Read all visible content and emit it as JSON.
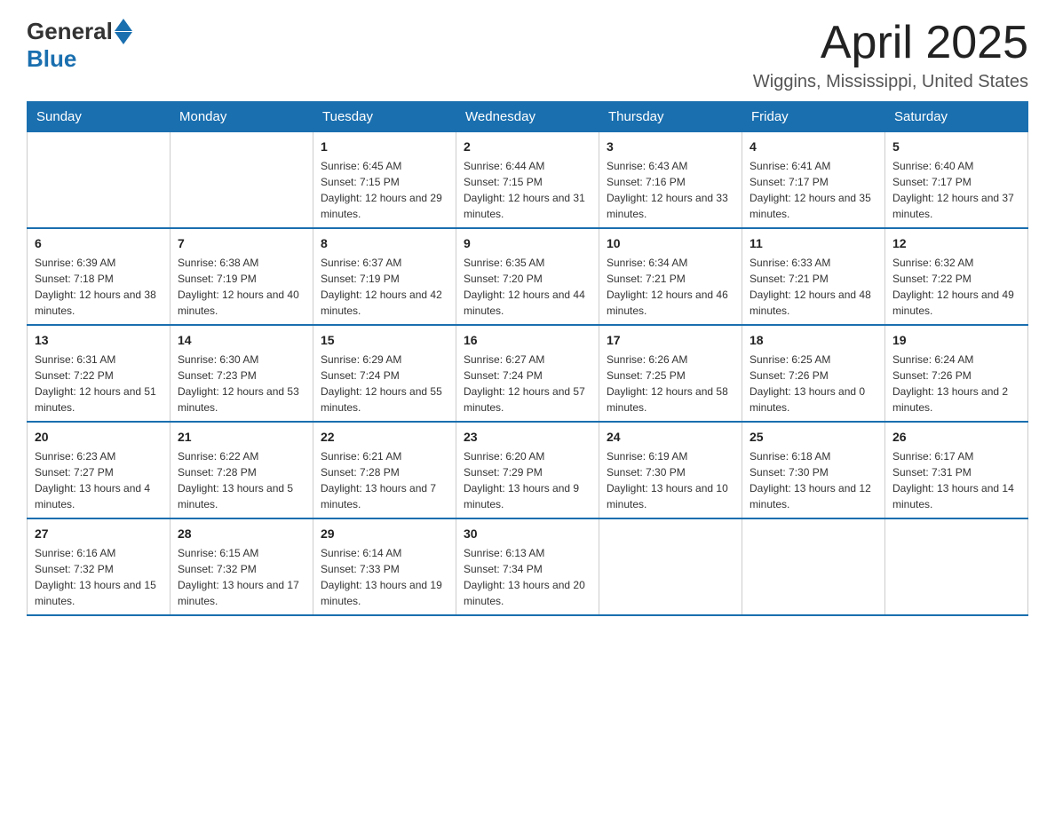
{
  "header": {
    "logo_general": "General",
    "logo_blue": "Blue",
    "month_year": "April 2025",
    "location": "Wiggins, Mississippi, United States"
  },
  "days_of_week": [
    "Sunday",
    "Monday",
    "Tuesday",
    "Wednesday",
    "Thursday",
    "Friday",
    "Saturday"
  ],
  "weeks": [
    [
      {
        "day": "",
        "sunrise": "",
        "sunset": "",
        "daylight": ""
      },
      {
        "day": "",
        "sunrise": "",
        "sunset": "",
        "daylight": ""
      },
      {
        "day": "1",
        "sunrise": "Sunrise: 6:45 AM",
        "sunset": "Sunset: 7:15 PM",
        "daylight": "Daylight: 12 hours and 29 minutes."
      },
      {
        "day": "2",
        "sunrise": "Sunrise: 6:44 AM",
        "sunset": "Sunset: 7:15 PM",
        "daylight": "Daylight: 12 hours and 31 minutes."
      },
      {
        "day": "3",
        "sunrise": "Sunrise: 6:43 AM",
        "sunset": "Sunset: 7:16 PM",
        "daylight": "Daylight: 12 hours and 33 minutes."
      },
      {
        "day": "4",
        "sunrise": "Sunrise: 6:41 AM",
        "sunset": "Sunset: 7:17 PM",
        "daylight": "Daylight: 12 hours and 35 minutes."
      },
      {
        "day": "5",
        "sunrise": "Sunrise: 6:40 AM",
        "sunset": "Sunset: 7:17 PM",
        "daylight": "Daylight: 12 hours and 37 minutes."
      }
    ],
    [
      {
        "day": "6",
        "sunrise": "Sunrise: 6:39 AM",
        "sunset": "Sunset: 7:18 PM",
        "daylight": "Daylight: 12 hours and 38 minutes."
      },
      {
        "day": "7",
        "sunrise": "Sunrise: 6:38 AM",
        "sunset": "Sunset: 7:19 PM",
        "daylight": "Daylight: 12 hours and 40 minutes."
      },
      {
        "day": "8",
        "sunrise": "Sunrise: 6:37 AM",
        "sunset": "Sunset: 7:19 PM",
        "daylight": "Daylight: 12 hours and 42 minutes."
      },
      {
        "day": "9",
        "sunrise": "Sunrise: 6:35 AM",
        "sunset": "Sunset: 7:20 PM",
        "daylight": "Daylight: 12 hours and 44 minutes."
      },
      {
        "day": "10",
        "sunrise": "Sunrise: 6:34 AM",
        "sunset": "Sunset: 7:21 PM",
        "daylight": "Daylight: 12 hours and 46 minutes."
      },
      {
        "day": "11",
        "sunrise": "Sunrise: 6:33 AM",
        "sunset": "Sunset: 7:21 PM",
        "daylight": "Daylight: 12 hours and 48 minutes."
      },
      {
        "day": "12",
        "sunrise": "Sunrise: 6:32 AM",
        "sunset": "Sunset: 7:22 PM",
        "daylight": "Daylight: 12 hours and 49 minutes."
      }
    ],
    [
      {
        "day": "13",
        "sunrise": "Sunrise: 6:31 AM",
        "sunset": "Sunset: 7:22 PM",
        "daylight": "Daylight: 12 hours and 51 minutes."
      },
      {
        "day": "14",
        "sunrise": "Sunrise: 6:30 AM",
        "sunset": "Sunset: 7:23 PM",
        "daylight": "Daylight: 12 hours and 53 minutes."
      },
      {
        "day": "15",
        "sunrise": "Sunrise: 6:29 AM",
        "sunset": "Sunset: 7:24 PM",
        "daylight": "Daylight: 12 hours and 55 minutes."
      },
      {
        "day": "16",
        "sunrise": "Sunrise: 6:27 AM",
        "sunset": "Sunset: 7:24 PM",
        "daylight": "Daylight: 12 hours and 57 minutes."
      },
      {
        "day": "17",
        "sunrise": "Sunrise: 6:26 AM",
        "sunset": "Sunset: 7:25 PM",
        "daylight": "Daylight: 12 hours and 58 minutes."
      },
      {
        "day": "18",
        "sunrise": "Sunrise: 6:25 AM",
        "sunset": "Sunset: 7:26 PM",
        "daylight": "Daylight: 13 hours and 0 minutes."
      },
      {
        "day": "19",
        "sunrise": "Sunrise: 6:24 AM",
        "sunset": "Sunset: 7:26 PM",
        "daylight": "Daylight: 13 hours and 2 minutes."
      }
    ],
    [
      {
        "day": "20",
        "sunrise": "Sunrise: 6:23 AM",
        "sunset": "Sunset: 7:27 PM",
        "daylight": "Daylight: 13 hours and 4 minutes."
      },
      {
        "day": "21",
        "sunrise": "Sunrise: 6:22 AM",
        "sunset": "Sunset: 7:28 PM",
        "daylight": "Daylight: 13 hours and 5 minutes."
      },
      {
        "day": "22",
        "sunrise": "Sunrise: 6:21 AM",
        "sunset": "Sunset: 7:28 PM",
        "daylight": "Daylight: 13 hours and 7 minutes."
      },
      {
        "day": "23",
        "sunrise": "Sunrise: 6:20 AM",
        "sunset": "Sunset: 7:29 PM",
        "daylight": "Daylight: 13 hours and 9 minutes."
      },
      {
        "day": "24",
        "sunrise": "Sunrise: 6:19 AM",
        "sunset": "Sunset: 7:30 PM",
        "daylight": "Daylight: 13 hours and 10 minutes."
      },
      {
        "day": "25",
        "sunrise": "Sunrise: 6:18 AM",
        "sunset": "Sunset: 7:30 PM",
        "daylight": "Daylight: 13 hours and 12 minutes."
      },
      {
        "day": "26",
        "sunrise": "Sunrise: 6:17 AM",
        "sunset": "Sunset: 7:31 PM",
        "daylight": "Daylight: 13 hours and 14 minutes."
      }
    ],
    [
      {
        "day": "27",
        "sunrise": "Sunrise: 6:16 AM",
        "sunset": "Sunset: 7:32 PM",
        "daylight": "Daylight: 13 hours and 15 minutes."
      },
      {
        "day": "28",
        "sunrise": "Sunrise: 6:15 AM",
        "sunset": "Sunset: 7:32 PM",
        "daylight": "Daylight: 13 hours and 17 minutes."
      },
      {
        "day": "29",
        "sunrise": "Sunrise: 6:14 AM",
        "sunset": "Sunset: 7:33 PM",
        "daylight": "Daylight: 13 hours and 19 minutes."
      },
      {
        "day": "30",
        "sunrise": "Sunrise: 6:13 AM",
        "sunset": "Sunset: 7:34 PM",
        "daylight": "Daylight: 13 hours and 20 minutes."
      },
      {
        "day": "",
        "sunrise": "",
        "sunset": "",
        "daylight": ""
      },
      {
        "day": "",
        "sunrise": "",
        "sunset": "",
        "daylight": ""
      },
      {
        "day": "",
        "sunrise": "",
        "sunset": "",
        "daylight": ""
      }
    ]
  ]
}
